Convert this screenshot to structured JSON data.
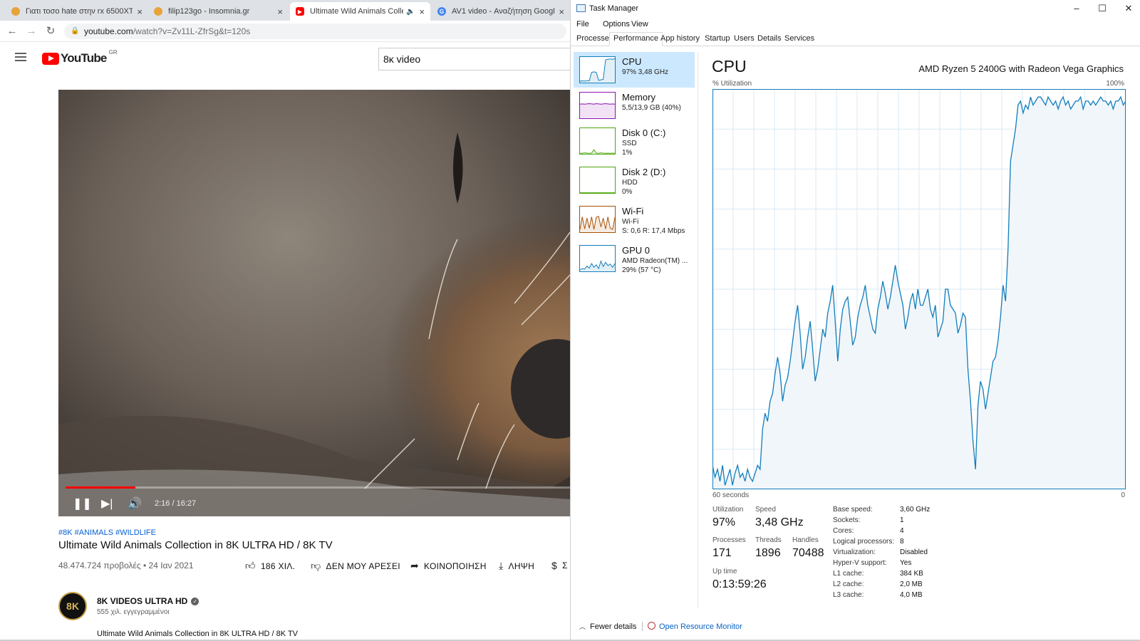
{
  "browser": {
    "tabs": [
      {
        "title": "Γιατι τοσο hate στην rx 6500XT - ...",
        "favicon_color": "#e8a33a"
      },
      {
        "title": "filip123go - Insomnia.gr",
        "favicon_color": "#e8a33a"
      },
      {
        "title": "Ultimate Wild Animals Collec...",
        "favicon_color": "#ff0000",
        "sound_icon": "speaker-icon"
      },
      {
        "title": "AV1 video - Αναζήτηση Google",
        "favicon_color": "#4285f4"
      }
    ],
    "address": {
      "host": "youtube.com",
      "path": "/watch?v=Zv11L-ZfrSg&t=120s"
    },
    "nav_icons": [
      "back-arrow-icon",
      "forward-arrow-icon",
      "reload-icon",
      "lock-icon"
    ]
  },
  "youtube": {
    "logo_text": "YouTube",
    "region": "GR",
    "search_value": "8κ video",
    "player": {
      "time": "2:16 / 16:27",
      "progress_fraction": 0.138
    },
    "tags": "#8K #ANIMALS #WILDLIFE",
    "title": "Ultimate Wild Animals Collection in 8K ULTRA HD / 8K TV",
    "meta": "48.474.724 προβολές • 24 Ιαν 2021",
    "actions": {
      "like": "186 ΧΙΛ.",
      "dislike": "ΔΕΝ ΜΟΥ ΑΡΕΣΕΙ",
      "share": "ΚΟΙΝΟΠΟΙΗΣΗ",
      "download": "ΛΗΨΗ",
      "thanks": "Σ"
    },
    "channel": {
      "avatar_text": "8K",
      "name": "8K VIDEOS ULTRA HD",
      "verified_glyph": "✓",
      "subs": "555 χιλ. εγγεγραμμένοι"
    },
    "description": "Ultimate Wild Animals Collection in 8K ULTRA HD / 8K TV"
  },
  "taskmgr": {
    "title": "Task Manager",
    "menu": [
      "File",
      "Options",
      "View"
    ],
    "tabs": [
      "Processes",
      "Performance",
      "App history",
      "Startup",
      "Users",
      "Details",
      "Services"
    ],
    "active_tab": "Performance",
    "sidebar": [
      {
        "name": "CPU",
        "sub": [
          "97%  3,48 GHz"
        ],
        "color": "#117dbb"
      },
      {
        "name": "Memory",
        "sub": [
          "5,5/13,9 GB (40%)"
        ],
        "color": "#8b12ae"
      },
      {
        "name": "Disk 0 (C:)",
        "sub": [
          "SSD",
          "1%"
        ],
        "color": "#4da60c"
      },
      {
        "name": "Disk 2 (D:)",
        "sub": [
          "HDD",
          "0%"
        ],
        "color": "#4da60c"
      },
      {
        "name": "Wi-Fi",
        "sub": [
          "Wi-Fi",
          "S: 0,6  R: 17,4 Mbps"
        ],
        "color": "#a74f01"
      },
      {
        "name": "GPU 0",
        "sub": [
          "AMD Radeon(TM) ...",
          "29%  (57 °C)"
        ],
        "color": "#117dbb"
      }
    ],
    "cpu": {
      "heading": "CPU",
      "model": "AMD Ryzen 5 2400G with Radeon Vega Graphics",
      "graph_label": "% Utilization",
      "graph_max": "100%",
      "time_label": "60 seconds",
      "time_end": "0",
      "line_color": "#117dbb",
      "fill_color": "#f1f6fa",
      "series": [
        6,
        3,
        5,
        2,
        6,
        1,
        3,
        5,
        1,
        4,
        6,
        3,
        4,
        2,
        5,
        3,
        2,
        4,
        6,
        5,
        15,
        19,
        17,
        22,
        24,
        29,
        33,
        29,
        22,
        26,
        28,
        32,
        37,
        42,
        46,
        39,
        30,
        33,
        38,
        42,
        35,
        27,
        30,
        35,
        40,
        38,
        44,
        47,
        51,
        42,
        32,
        40,
        45,
        47,
        48,
        42,
        36,
        38,
        43,
        46,
        48,
        51,
        46,
        43,
        40,
        39,
        45,
        48,
        52,
        49,
        45,
        48,
        52,
        56,
        52,
        49,
        46,
        40,
        43,
        47,
        49,
        45,
        50,
        46,
        46,
        48,
        50,
        45,
        43,
        46,
        38,
        40,
        42,
        50,
        50,
        46,
        45,
        44,
        39,
        41,
        44,
        43,
        30,
        22,
        12,
        5,
        21,
        27,
        25,
        20,
        24,
        28,
        32,
        33,
        37,
        43,
        51,
        47,
        60,
        82,
        86,
        90,
        96,
        97,
        94,
        96,
        95,
        98,
        96,
        97,
        98,
        98,
        97,
        96,
        98,
        97,
        96,
        97,
        95,
        97,
        98,
        96,
        97,
        95,
        96,
        97,
        97,
        98,
        95,
        97,
        97,
        96,
        97,
        96,
        97,
        98,
        97,
        97,
        96,
        97,
        95,
        97,
        97,
        98,
        96,
        97
      ]
    },
    "stats": {
      "utilization": {
        "label": "Utilization",
        "value": "97%"
      },
      "speed": {
        "label": "Speed",
        "value": "3,48 GHz"
      },
      "processes": {
        "label": "Processes",
        "value": "171"
      },
      "threads": {
        "label": "Threads",
        "value": "1896"
      },
      "handles": {
        "label": "Handles",
        "value": "70488"
      },
      "uptime": {
        "label": "Up time",
        "value": "0:13:59:26"
      }
    },
    "details": [
      {
        "k": "Base speed:",
        "v": "3,60 GHz"
      },
      {
        "k": "Sockets:",
        "v": "1"
      },
      {
        "k": "Cores:",
        "v": "4"
      },
      {
        "k": "Logical processors:",
        "v": "8"
      },
      {
        "k": "Virtualization:",
        "v": "Disabled"
      },
      {
        "k": "Hyper-V support:",
        "v": "Yes"
      },
      {
        "k": "L1 cache:",
        "v": "384 KB"
      },
      {
        "k": "L2 cache:",
        "v": "2,0 MB"
      },
      {
        "k": "L3 cache:",
        "v": "4,0 MB"
      }
    ],
    "footer": {
      "fewer": "Fewer details",
      "resource_monitor": "Open Resource Monitor"
    }
  }
}
